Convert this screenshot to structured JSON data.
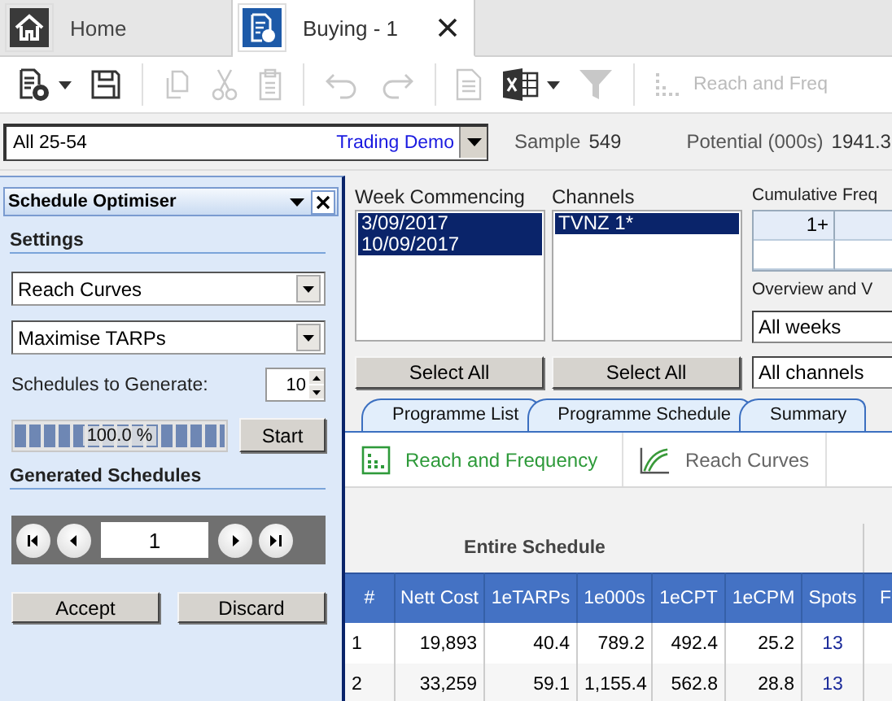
{
  "tabs": [
    {
      "label": "Home",
      "kind": "home",
      "selected": false,
      "closable": false
    },
    {
      "label": "Buying - 1",
      "kind": "buying",
      "selected": true,
      "closable": true
    }
  ],
  "toolbar": [
    {
      "kind": "schedule",
      "disabled": false,
      "menu": true
    },
    {
      "kind": "save",
      "disabled": false,
      "menu": false
    },
    {
      "kind": "copy",
      "disabled": true,
      "menu": false
    },
    {
      "kind": "cut",
      "disabled": true,
      "menu": false
    },
    {
      "kind": "paste",
      "disabled": true,
      "menu": false
    },
    {
      "kind": "undo",
      "disabled": true,
      "menu": false
    },
    {
      "kind": "redo",
      "disabled": true,
      "menu": false
    },
    {
      "kind": "document",
      "disabled": true,
      "menu": false
    },
    {
      "kind": "excel",
      "disabled": false,
      "menu": true
    },
    {
      "kind": "filter",
      "disabled": true,
      "menu": false
    },
    {
      "kind": "chart",
      "disabled": true,
      "menu": false,
      "label": "Reach and Freq"
    }
  ],
  "audience": {
    "value": "All 25-54",
    "source": "Trading Demo",
    "sample_label": "Sample",
    "sample": "549",
    "potential_label": "Potential (000s)",
    "potential": "1941.3"
  },
  "optimiser": {
    "title": "Schedule Optimiser",
    "settings_heading": "Settings",
    "curve": "Reach Curves",
    "goal": "Maximise TARPs",
    "count_label": "Schedules to Generate:",
    "count": "10",
    "progress": {
      "level": 1.0,
      "reading": "100.0 %"
    },
    "start": "Start",
    "generated_heading": "Generated Schedules",
    "current": "1",
    "buttons": [
      "Accept",
      "Discard"
    ]
  },
  "weeks": {
    "label": "Week Commencing",
    "items": [
      {
        "text": "3/09/2017",
        "selected": true
      },
      {
        "text": "10/09/2017",
        "selected": true
      }
    ],
    "button": "Select All"
  },
  "channels": {
    "label": "Channels",
    "items": [
      {
        "text": "TVNZ 1*",
        "selected": true
      }
    ],
    "button": "Select All"
  },
  "cumulative": {
    "label": "Cumulative Freq",
    "cell": "1+",
    "overview_label": "Overview and V",
    "weeks_filter": "All weeks",
    "channels_filter": "All channels"
  },
  "programme_tabs": [
    "Programme List",
    "Programme Schedule",
    "Summary"
  ],
  "view_tabs": [
    {
      "label": "Reach and Frequency",
      "kind": "bars",
      "selected": true
    },
    {
      "label": "Reach Curves",
      "kind": "curve",
      "selected": false
    }
  ],
  "table": {
    "group": "Entire Schedule",
    "columns": [
      "#",
      "Nett Cost",
      "1eTARPs",
      "1e000s",
      "1eCPT",
      "1eCPM",
      "Spots",
      "F"
    ],
    "rows": [
      [
        "1",
        "19,893",
        "40.4",
        "789.2",
        "492.4",
        "25.2",
        "13"
      ],
      [
        "2",
        "33,259",
        "59.1",
        "1,155.4",
        "562.8",
        "28.8",
        "13"
      ]
    ]
  }
}
